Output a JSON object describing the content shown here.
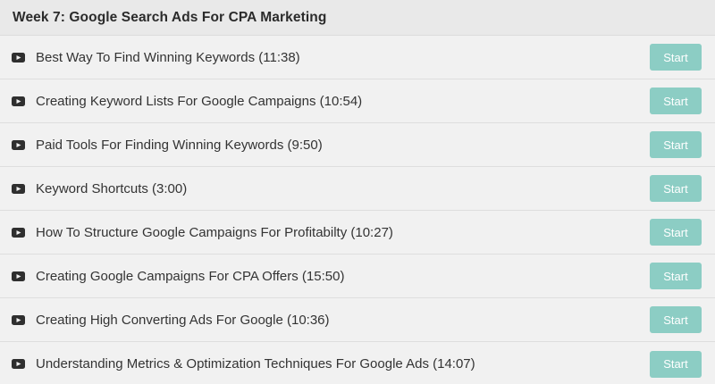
{
  "section": {
    "title": "Week 7: Google Search Ads For CPA Marketing"
  },
  "lectures": [
    {
      "title": "Best Way To Find Winning Keywords (11:38)",
      "button": "Start",
      "icon": "video-play-icon"
    },
    {
      "title": "Creating Keyword Lists For Google Campaigns (10:54)",
      "button": "Start",
      "icon": "video-play-icon"
    },
    {
      "title": "Paid Tools For Finding Winning Keywords (9:50)",
      "button": "Start",
      "icon": "video-play-icon"
    },
    {
      "title": "Keyword Shortcuts (3:00)",
      "button": "Start",
      "icon": "video-play-icon"
    },
    {
      "title": "How To Structure Google Campaigns For Profitabilty (10:27)",
      "button": "Start",
      "icon": "video-play-icon"
    },
    {
      "title": "Creating Google Campaigns For CPA Offers (15:50)",
      "button": "Start",
      "icon": "video-play-icon"
    },
    {
      "title": "Creating High Converting Ads For Google (10:36)",
      "button": "Start",
      "icon": "video-play-icon"
    },
    {
      "title": "Understanding Metrics & Optimization Techniques For Google Ads (14:07)",
      "button": "Start",
      "icon": "video-play-icon"
    }
  ],
  "colors": {
    "header_bg": "#e9e9e9",
    "row_bg": "#f1f1f1",
    "button_bg": "#8ccdc4",
    "button_text": "#ffffff",
    "text": "#333333"
  }
}
